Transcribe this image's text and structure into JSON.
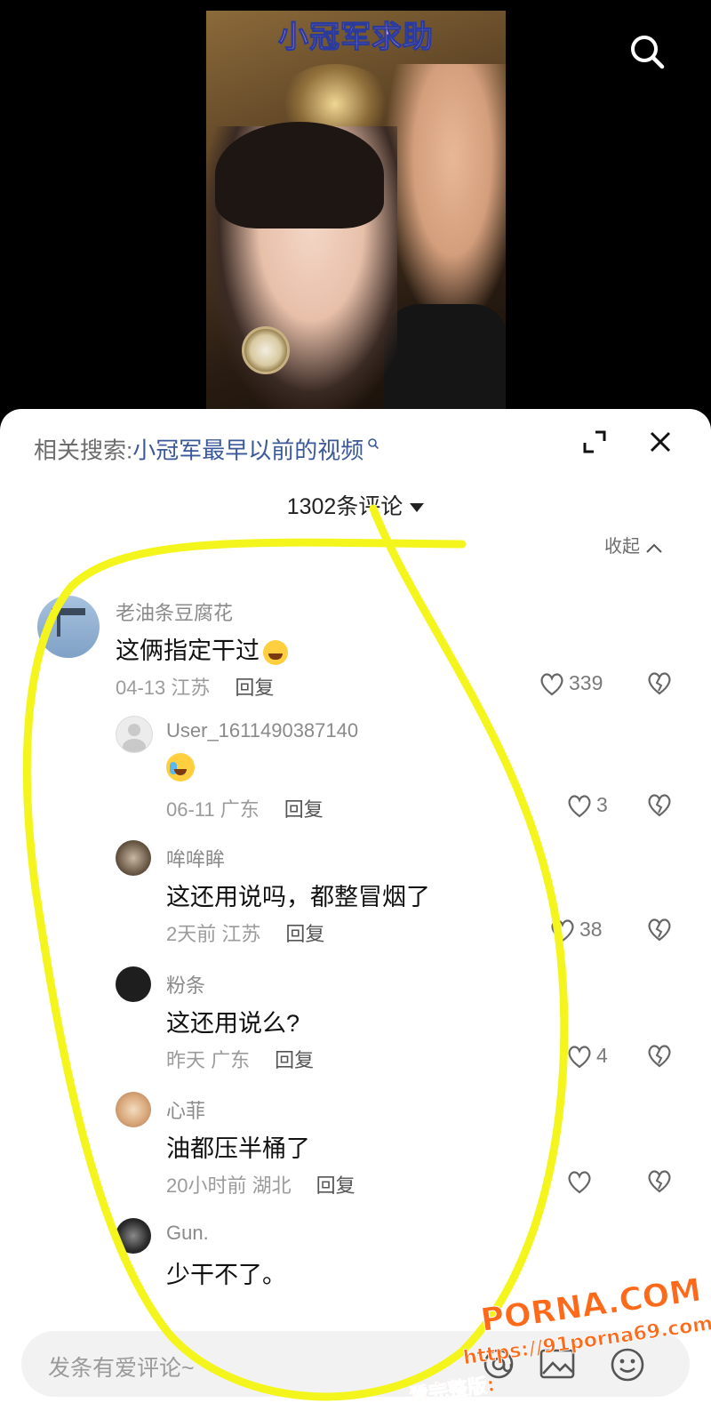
{
  "video": {
    "title_overlay": "小冠军求助",
    "search_icon": "search-icon"
  },
  "sheet": {
    "related_label": "相关搜索:",
    "related_query": "小冠军最早以前的视频",
    "count_label": "1302条评论",
    "collapse_label": "收起"
  },
  "comments": [
    {
      "user": "老油条豆腐花",
      "text": "这俩指定干过",
      "emoji": "laughing-tears",
      "time": "04-13",
      "location": "江苏",
      "reply": "回复",
      "likes": "339"
    },
    {
      "user": "User_1611490387140",
      "text": "",
      "emoji": "crying",
      "time": "06-11",
      "location": "广东",
      "reply": "回复",
      "likes": "3"
    },
    {
      "user": "哞哞眸",
      "text": "这还用说吗，都整冒烟了",
      "time": "2天前",
      "location": "江苏",
      "reply": "回复",
      "likes": "38"
    },
    {
      "user": "粉条",
      "text": "这还用说么?",
      "time": "昨天",
      "location": "广东",
      "reply": "回复",
      "likes": "4"
    },
    {
      "user": "心菲",
      "text": "油都压半桶了",
      "time": "20小时前",
      "location": "湖北",
      "reply": "回复",
      "likes": ""
    },
    {
      "user": "Gun.",
      "text": "少干不了。"
    }
  ],
  "input": {
    "placeholder": "发条有爱评论~"
  },
  "watermark": {
    "brand": "PORNA.COM",
    "url": "https://91porna69.com",
    "note": "看完整版:"
  },
  "colors": {
    "highlight": "#f5f51e",
    "watermark": "#ff6a1a",
    "link": "#3b5998"
  }
}
